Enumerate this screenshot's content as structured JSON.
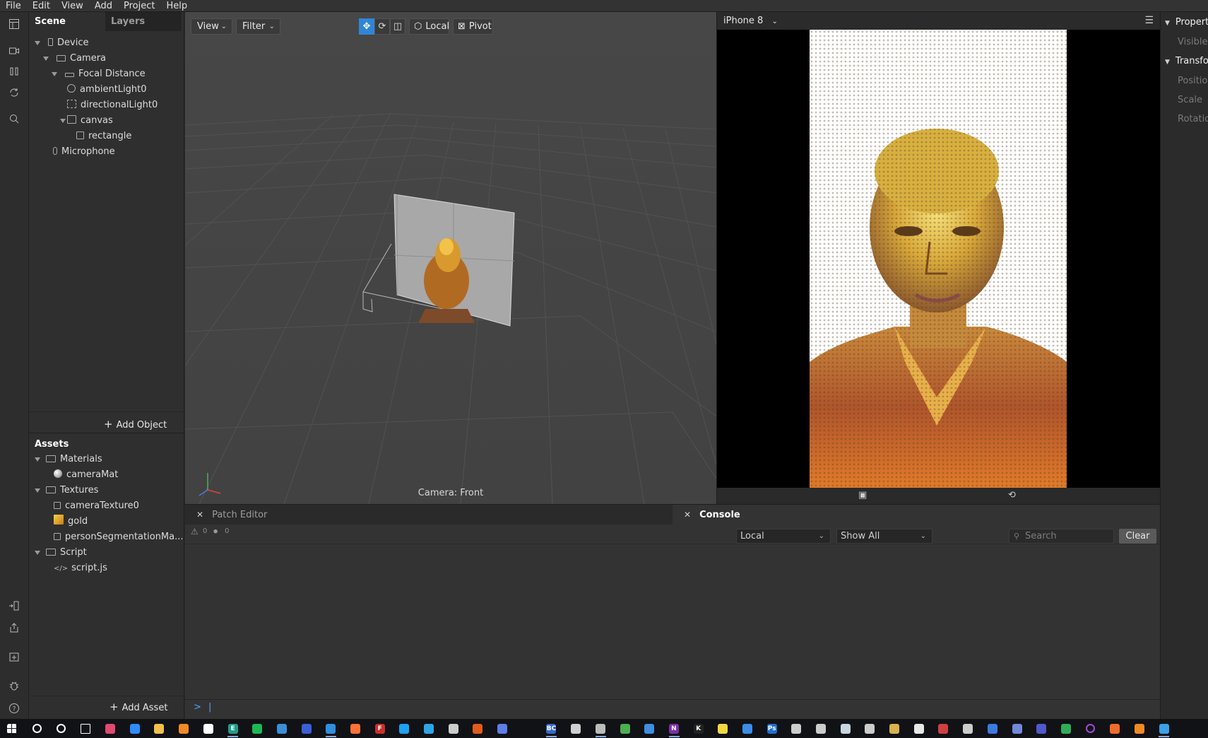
{
  "menubar": [
    "File",
    "Edit",
    "View",
    "Add",
    "Project",
    "Help"
  ],
  "scene_panel": {
    "tabs": [
      "Scene",
      "Layers"
    ],
    "tree": [
      {
        "label": "Device",
        "icon": "phone-icon"
      },
      {
        "label": "Camera",
        "icon": "camera-icon"
      },
      {
        "label": "Focal Distance",
        "icon": "ruler-icon"
      },
      {
        "label": "ambientLight0",
        "icon": "globe-icon"
      },
      {
        "label": "directionalLight0",
        "icon": "light-icon"
      },
      {
        "label": "canvas",
        "icon": "canvas-icon"
      },
      {
        "label": "rectangle",
        "icon": "rectangle-icon"
      },
      {
        "label": "Microphone",
        "icon": "microphone-icon"
      }
    ],
    "add_object": "Add Object"
  },
  "assets_panel": {
    "title": "Assets",
    "tree": [
      {
        "label": "Materials",
        "icon": "folder-icon"
      },
      {
        "label": "cameraMat",
        "icon": "sphere-icon"
      },
      {
        "label": "Textures",
        "icon": "folder-icon"
      },
      {
        "label": "cameraTexture0",
        "icon": "texture-icon"
      },
      {
        "label": "gold",
        "icon": "gold-texture-icon"
      },
      {
        "label": "personSegmentationMa...",
        "icon": "texture-icon"
      },
      {
        "label": "Script",
        "icon": "folder-icon"
      },
      {
        "label": "script.js",
        "icon": "code-icon"
      }
    ],
    "add_asset": "Add Asset"
  },
  "viewport": {
    "view_menu": "View",
    "filter_menu": "Filter",
    "local_button": "Local",
    "pivot_button": "Pivot",
    "camera_caption": "Camera: Front"
  },
  "simulator": {
    "device": "iPhone 8"
  },
  "properties": {
    "headers": [
      "Properti",
      "Transfor"
    ],
    "labels": [
      "Visible",
      "Position",
      "Scale",
      "Rotation"
    ]
  },
  "bottom": {
    "patch_editor_tab": "Patch Editor",
    "console_tab": "Console",
    "warning_count": "0",
    "error_count": "0",
    "scope_select": "Local",
    "filter_select": "Show All",
    "search_placeholder": "Search",
    "clear_button": "Clear",
    "prompt": ">"
  },
  "colors": {
    "accent": "#2f86d6",
    "panel": "#2f2f2f",
    "viewport": "#444444"
  },
  "taskbar": {
    "apps": [
      {
        "name": "windows-start-icon",
        "color": "#ffffff",
        "label": ""
      },
      {
        "name": "search-icon",
        "color": "#ffffff",
        "label": ""
      },
      {
        "name": "cortana-icon",
        "color": "#ffffff",
        "label": ""
      },
      {
        "name": "task-view-icon",
        "color": "#ffffff",
        "label": ""
      },
      {
        "name": "pinwheel-app-icon",
        "color": "#e04a6f",
        "label": ""
      },
      {
        "name": "zoom-icon",
        "color": "#2d8cff",
        "label": ""
      },
      {
        "name": "file-explorer-icon",
        "color": "#f2c04b",
        "label": ""
      },
      {
        "name": "search-app-icon",
        "color": "#f08a24",
        "label": ""
      },
      {
        "name": "store-icon",
        "color": "#ffffff",
        "label": ""
      },
      {
        "name": "edge-app-icon",
        "color": "#1f9d8a",
        "label": "E"
      },
      {
        "name": "spotify-icon",
        "color": "#1db954",
        "label": ""
      },
      {
        "name": "edge-icon",
        "color": "#3a8fd6",
        "label": ""
      },
      {
        "name": "save-app-icon",
        "color": "#3b5fd6",
        "label": ""
      },
      {
        "name": "vscode-icon",
        "color": "#2f8fe0",
        "label": ""
      },
      {
        "name": "firefox-icon",
        "color": "#ff7139",
        "label": ""
      },
      {
        "name": "filezilla-icon",
        "color": "#c9302c",
        "label": "F"
      },
      {
        "name": "twitter-icon",
        "color": "#1da1f2",
        "label": ""
      },
      {
        "name": "info-app-icon",
        "color": "#2da5e8",
        "label": ""
      },
      {
        "name": "stack-app-icon",
        "color": "#cccccc",
        "label": ""
      },
      {
        "name": "office-app-icon",
        "color": "#e35b1c",
        "label": ""
      },
      {
        "name": "instagram-app-icon",
        "color": "#5f7de8",
        "label": ""
      },
      {
        "name": "spacer-icon",
        "color": "transparent",
        "label": ""
      },
      {
        "name": "bc-app-icon",
        "color": "#3568c9",
        "label": "BC"
      },
      {
        "name": "terminal-icon",
        "color": "#cfcfcf",
        "label": ""
      },
      {
        "name": "cmd-icon",
        "color": "#bbbbbb",
        "label": ""
      },
      {
        "name": "chrome-icon",
        "color": "#4caf50",
        "label": ""
      },
      {
        "name": "mail-icon",
        "color": "#3f8ee0",
        "label": ""
      },
      {
        "name": "onenote-icon",
        "color": "#7b2fa8",
        "label": "N"
      },
      {
        "name": "k-app-icon",
        "color": "#222222",
        "label": "K"
      },
      {
        "name": "sticky-notes-icon",
        "color": "#f5d742",
        "label": ""
      },
      {
        "name": "todo-icon",
        "color": "#3a8ee6",
        "label": ""
      },
      {
        "name": "photoshop-icon",
        "color": "#1f6fd1",
        "label": "Ps"
      },
      {
        "name": "building-app-icon",
        "color": "#cccccc",
        "label": ""
      },
      {
        "name": "tools-app-icon",
        "color": "#cccccc",
        "label": ""
      },
      {
        "name": "steam-icon",
        "color": "#c7d5e0",
        "label": ""
      },
      {
        "name": "plane-app-icon",
        "color": "#cccccc",
        "label": ""
      },
      {
        "name": "archive-app-icon",
        "color": "#d8b24a",
        "label": ""
      },
      {
        "name": "document-icon",
        "color": "#e8e8e8",
        "label": ""
      },
      {
        "name": "video-app-icon",
        "color": "#d04040",
        "label": ""
      },
      {
        "name": "screen-app-icon",
        "color": "#cccccc",
        "label": ""
      },
      {
        "name": "calendar-icon",
        "color": "#3a7be0",
        "label": ""
      },
      {
        "name": "discord-icon",
        "color": "#7289da",
        "label": ""
      },
      {
        "name": "teams-icon",
        "color": "#5059c9",
        "label": ""
      },
      {
        "name": "git-app-icon",
        "color": "#2fae55",
        "label": ""
      },
      {
        "name": "circle-app-icon",
        "color": "#a24bd6",
        "label": ""
      },
      {
        "name": "hex-app-icon",
        "color": "#f06c2a",
        "label": ""
      },
      {
        "name": "vlc-icon",
        "color": "#f08a24",
        "label": ""
      },
      {
        "name": "spark-ar-icon",
        "color": "#3aa0e8",
        "label": ""
      }
    ]
  }
}
